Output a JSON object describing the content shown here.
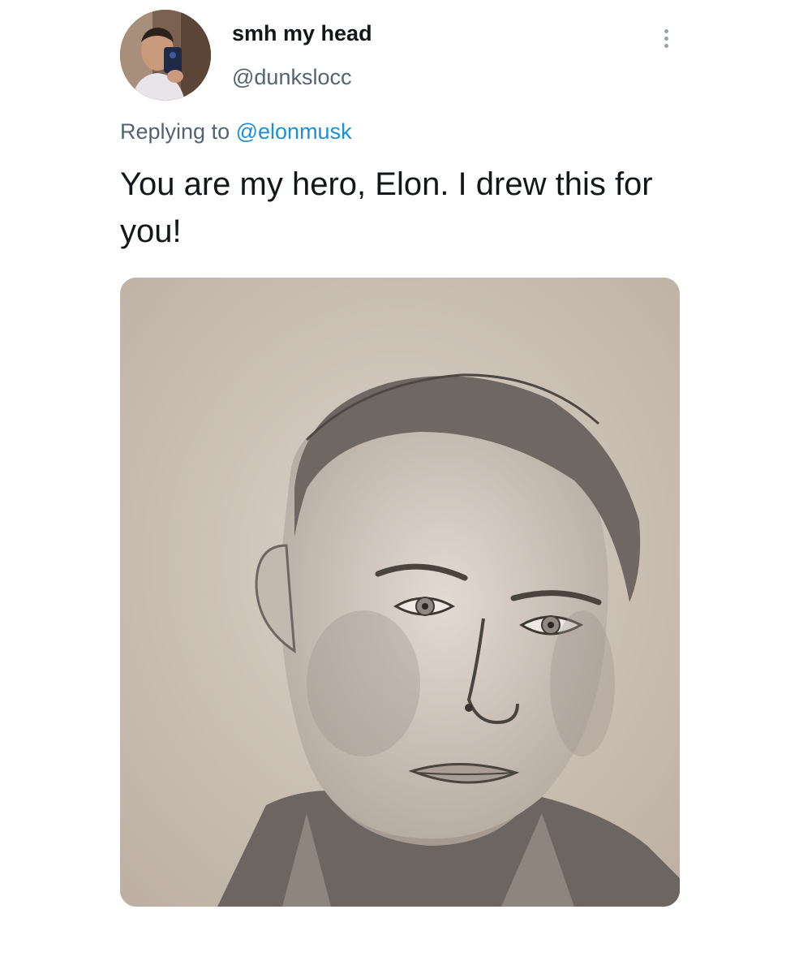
{
  "tweet": {
    "display_name": "smh my head",
    "handle": "@dunkslocc",
    "replying_prefix": "Replying to",
    "replying_to": "@elonmusk",
    "text": "You are my hero, Elon. I drew this for you!",
    "icons": {
      "avatar": "avatar",
      "more": "more-vertical-icon"
    },
    "media": {
      "type": "photo",
      "subject": "pencil-sketch-portrait"
    }
  },
  "colors": {
    "name_text": "#14171a",
    "secondary_text": "#536471",
    "mention_link": "#1d8fd8",
    "background": "#ffffff"
  }
}
